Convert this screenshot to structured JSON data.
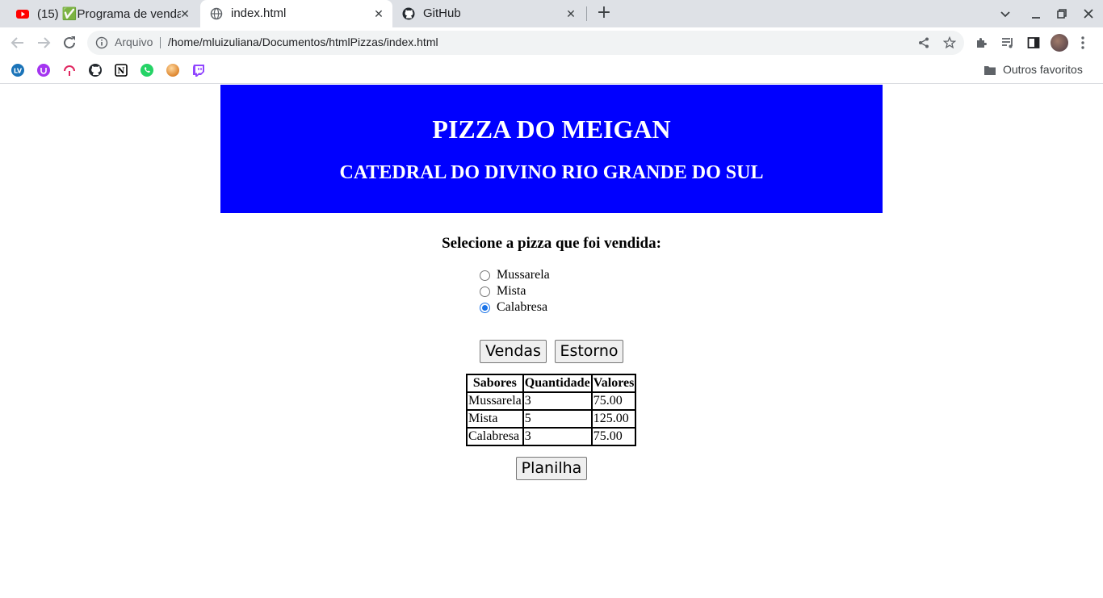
{
  "browser": {
    "tabs": [
      {
        "title": "(15) ✅Programa de venda",
        "active": false,
        "favicon": "youtube-icon"
      },
      {
        "title": "index.html",
        "active": true,
        "favicon": "globe-icon"
      },
      {
        "title": "GitHub",
        "active": false,
        "favicon": "github-icon"
      }
    ],
    "close_glyph": "✕",
    "new_tab_glyph": "+",
    "omnibox": {
      "scheme_label": "Arquivo",
      "url": "/home/mluizuliana/Documentos/htmlPizzas/index.html"
    },
    "bookmarks": {
      "icons": [
        "lv-icon",
        "udemy-icon",
        "app-icon",
        "github-icon",
        "notion-icon",
        "whatsapp-icon",
        "orange-ball-icon",
        "twitch-icon"
      ],
      "other_label": "Outros favoritos"
    },
    "colors": {
      "tabstrip": "#dee1e6",
      "omnibox": "#f1f3f4",
      "accent": "#1a73e8"
    }
  },
  "page": {
    "banner": {
      "title": "PIZZA DO MEIGAN",
      "subtitle": "CATEDRAL DO DIVINO RIO GRANDE DO SUL",
      "bg_color": "#0000ff"
    },
    "prompt": "Selecione a pizza que foi vendida:",
    "options": [
      {
        "label": "Mussarela",
        "checked": false
      },
      {
        "label": "Mista",
        "checked": false
      },
      {
        "label": "Calabresa",
        "checked": true
      }
    ],
    "buttons": {
      "sales": "Vendas",
      "refund": "Estorno",
      "sheet": "Planilha"
    },
    "table": {
      "headers": [
        "Sabores",
        "Quantidade",
        "Valores"
      ],
      "rows": [
        [
          "Mussarela",
          "3",
          "75.00"
        ],
        [
          "Mista",
          "5",
          "125.00"
        ],
        [
          "Calabresa",
          "3",
          "75.00"
        ]
      ]
    }
  }
}
